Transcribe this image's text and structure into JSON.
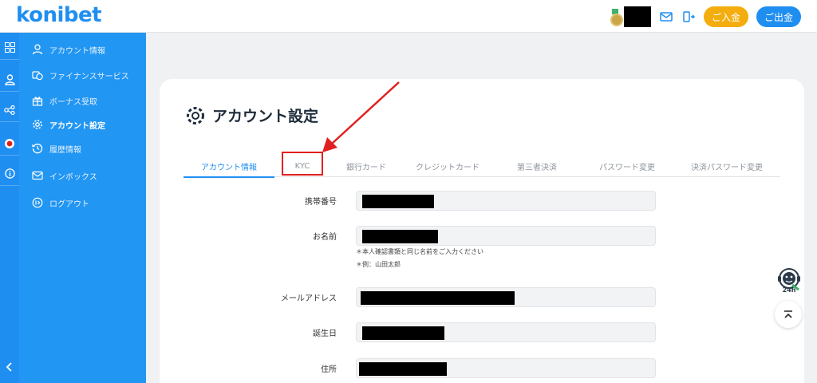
{
  "header": {
    "logo": "konibet",
    "deposit_label": "ご入金",
    "withdraw_label": "ご出金",
    "icons": [
      "medal-icon",
      "mail-icon",
      "logout-icon"
    ]
  },
  "rail": {
    "icons": [
      "grid-icon",
      "user-icon",
      "share-icon",
      "live-icon",
      "info-icon",
      "collapse-chevron-icon"
    ]
  },
  "sidebar": {
    "items": [
      {
        "label": "アカウント情報",
        "icon": "user-icon"
      },
      {
        "label": "ファイナンスサービス",
        "icon": "coins-icon"
      },
      {
        "label": "ボーナス受取",
        "icon": "gift-icon"
      },
      {
        "label": "アカウント設定",
        "icon": "gear-icon",
        "active": true
      },
      {
        "label": "履歴情報",
        "icon": "history-icon"
      },
      {
        "label": "インボックス",
        "icon": "mail-icon"
      },
      {
        "label": "ログアウト",
        "icon": "logout-icon"
      }
    ]
  },
  "main": {
    "title": "アカウント設定",
    "tabs": [
      {
        "label": "アカウント情報",
        "active": true
      },
      {
        "label": "KYC"
      },
      {
        "label": "銀行カード"
      },
      {
        "label": "クレジットカード"
      },
      {
        "label": "第三者決済"
      },
      {
        "label": "パスワード変更"
      },
      {
        "label": "決済パスワード変更"
      }
    ],
    "form": {
      "phone_label": "携帯番号",
      "name_label": "お名前",
      "name_hint_1": "＊本人確認書類と同じ名前をご入力ください",
      "name_hint_2": "＊例：山田太郎",
      "email_label": "メールアドレス",
      "birthday_label": "誕生日",
      "address_label": "住所"
    }
  },
  "floating": {
    "support_badge": "24h"
  },
  "colors": {
    "primary": "#1f8ef1",
    "sidebar": "#2196f3",
    "deposit": "#f4ad0e",
    "annotation": "#e02020"
  }
}
